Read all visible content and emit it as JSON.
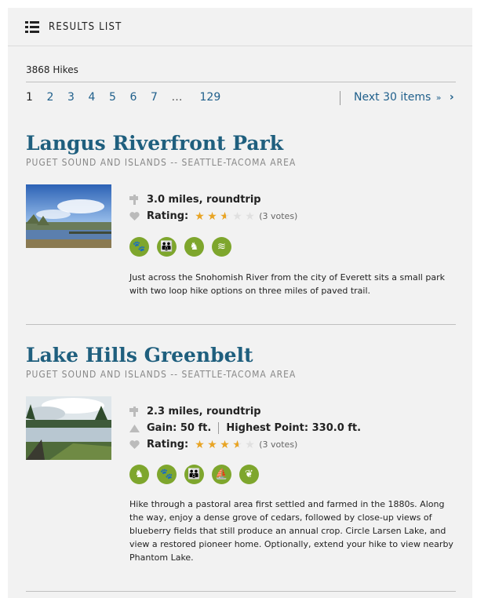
{
  "header": {
    "title": "RESULTS LIST",
    "icon": "list-icon"
  },
  "count_text": "3868 Hikes",
  "pagination": {
    "pages": [
      "1",
      "2",
      "3",
      "4",
      "5",
      "6",
      "7",
      "…",
      "129"
    ],
    "current": "1",
    "next_label": "Next 30 items",
    "next_raquo": "»",
    "next_chevron": "›"
  },
  "hikes": [
    {
      "name": "Langus Riverfront Park",
      "region": "PUGET SOUND AND ISLANDS -- SEATTLE-TACOMA AREA",
      "distance": "3.0 miles, roundtrip",
      "rating_label": "Rating:",
      "rating": 2.5,
      "votes": "(3 votes)",
      "features": [
        "dogs-allowed-icon",
        "kid-friendly-icon",
        "wildlife-icon",
        "rivers-icon"
      ],
      "description": "Just across the Snohomish River from the city of Everett sits a small park with two loop hike options on three miles of paved trail."
    },
    {
      "name": "Lake Hills Greenbelt",
      "region": "PUGET SOUND AND ISLANDS -- SEATTLE-TACOMA AREA",
      "distance": "2.3 miles, roundtrip",
      "gain": "Gain: 50 ft.",
      "highest_point": "Highest Point: 330.0 ft.",
      "rating_label": "Rating:",
      "rating": 3.5,
      "votes": "(3 votes)",
      "features": [
        "wildlife-icon",
        "dogs-allowed-icon",
        "kid-friendly-icon",
        "lakes-icon",
        "fall-foliage-icon"
      ],
      "description": "Hike through a pastoral area first settled and farmed in the 1880s. Along the way, enjoy a dense grove of cedars, followed by close-up views of blueberry fields that still produce an annual crop. Circle Larsen Lake, and view a restored pioneer home. Optionally, extend your hike to view nearby Phantom Lake."
    }
  ],
  "colors": {
    "link": "#1f5f8b",
    "title": "#1f5f7e",
    "feature": "#7ea62d",
    "star": "#e8a424"
  }
}
